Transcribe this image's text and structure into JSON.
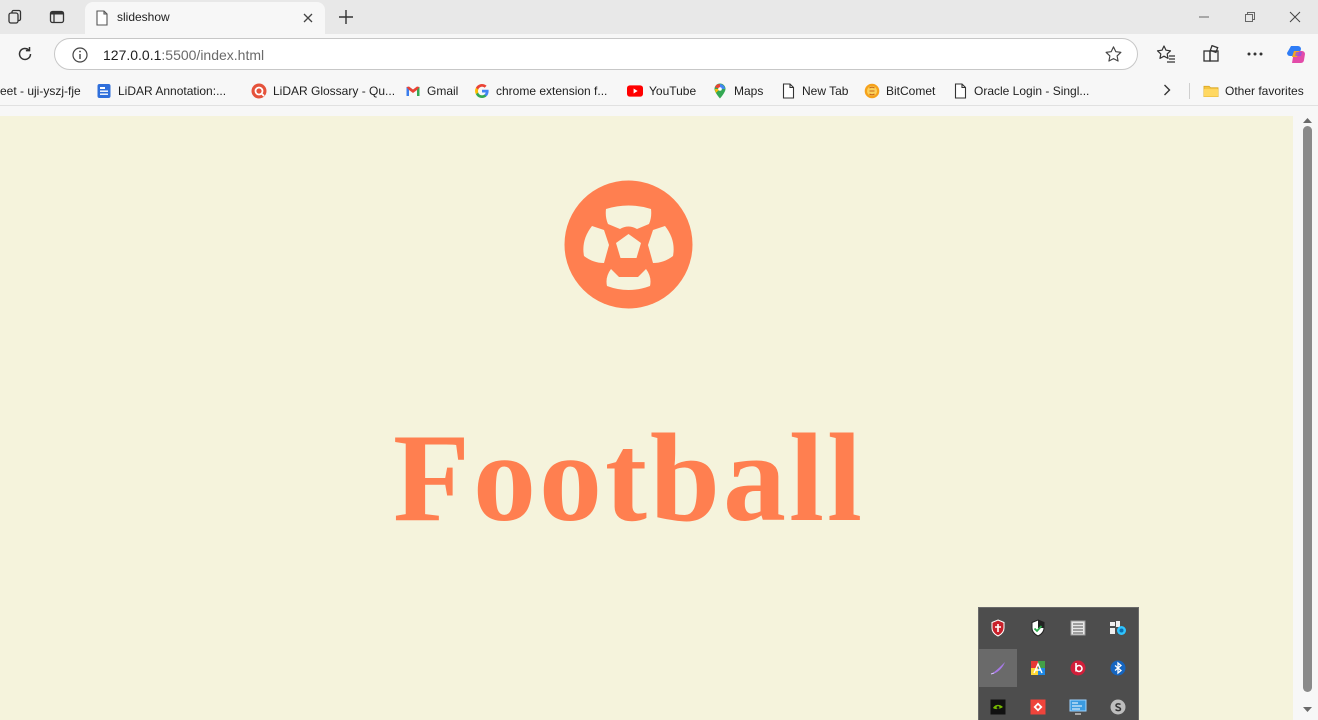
{
  "browser": {
    "tab": {
      "title": "slideshow"
    },
    "address": {
      "url_host": "127.0.0.1",
      "url_path": ":5500/index.html"
    },
    "bookmarks": [
      {
        "label": "eet - uji-yszj-fje",
        "icon": "meet-icon"
      },
      {
        "label": "LiDAR Annotation:...",
        "icon": "docs-icon"
      },
      {
        "label": "LiDAR Glossary - Qu...",
        "icon": "quizlet-icon"
      },
      {
        "label": "Gmail",
        "icon": "gmail-icon"
      },
      {
        "label": "chrome extension f...",
        "icon": "google-icon"
      },
      {
        "label": "YouTube",
        "icon": "youtube-icon"
      },
      {
        "label": "Maps",
        "icon": "maps-icon"
      },
      {
        "label": "New Tab",
        "icon": "page-icon"
      },
      {
        "label": "BitComet",
        "icon": "bitcomet-icon"
      },
      {
        "label": "Oracle Login - Singl...",
        "icon": "page-icon"
      }
    ],
    "other_favorites": "Other favorites"
  },
  "page": {
    "heading": "Football",
    "icon": "soccer-ball-icon",
    "background_color": "#f5f3dc",
    "accent_color": "#ff7f50"
  },
  "tray": {
    "icons": [
      "shield-red-icon",
      "shield-check-icon",
      "notepad-icon",
      "network-icon",
      "pen-icon",
      "color-app-icon",
      "beats-icon",
      "bluetooth-icon",
      "nvidia-icon",
      "anydesk-icon",
      "display-icon",
      "skype-icon"
    ]
  }
}
